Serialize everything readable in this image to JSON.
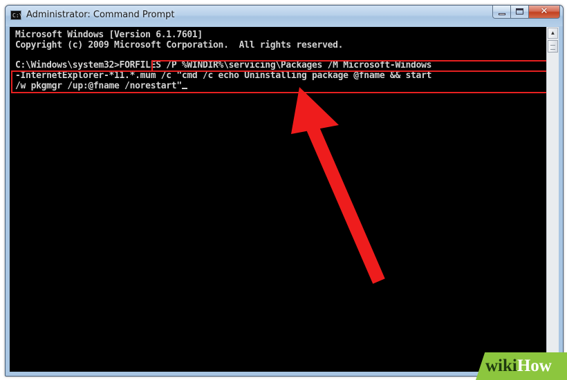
{
  "window": {
    "title": "Administrator: Command Prompt",
    "icon_label": "C:\\",
    "close_glyph": "✕"
  },
  "console": {
    "lines": [
      "Microsoft Windows [Version 6.1.7601]",
      "Copyright (c) 2009 Microsoft Corporation.  All rights reserved.",
      "",
      "C:\\Windows\\system32>",
      "-InternetExplorer-*11.*.mum /c \"cmd /c echo Uninstalling package @fname && start",
      "/w pkgmgr /up:@fname /norestart\""
    ],
    "prompt": "C:\\Windows\\system32>",
    "command_start": "FORFILES /P %WINDIR%\\servicing\\Packages /M Microsoft-Windows",
    "text_color": "#d2d2d2",
    "background": "#000000"
  },
  "annotation": {
    "highlight_color": "#e82020",
    "arrow_color": "#ee1c1c",
    "arrow_points_to": "command"
  },
  "watermark": {
    "wiki": "wiki",
    "how": "How",
    "color": "#8cc63e"
  }
}
